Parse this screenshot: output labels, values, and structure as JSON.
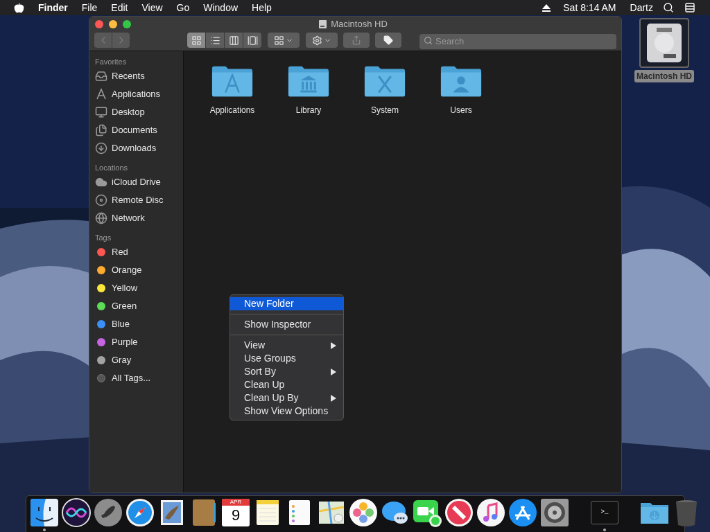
{
  "menu_bar": {
    "items": [
      {
        "label": "Finder",
        "kind": "app"
      },
      {
        "label": "File",
        "kind": "menu"
      },
      {
        "label": "Edit",
        "kind": "menu"
      },
      {
        "label": "View",
        "kind": "menu"
      },
      {
        "label": "Go",
        "kind": "menu"
      },
      {
        "label": "Window",
        "kind": "menu"
      },
      {
        "label": "Help",
        "kind": "menu"
      }
    ],
    "clock": "Sat 8:14 AM",
    "user": "Dartz"
  },
  "window": {
    "title": "Macintosh HD",
    "toolbar": {
      "navigation": [
        {
          "disabled": true
        },
        {
          "disabled": true
        }
      ],
      "view_modes": [
        {
          "selected": true
        },
        {
          "selected": false
        },
        {
          "selected": false
        },
        {
          "selected": false
        }
      ],
      "share_disabled": true,
      "search": {
        "placeholder": "Search"
      }
    },
    "sidebar": [
      {
        "title": "Favorites",
        "items": [
          {
            "label": "Recents",
            "kind": "recents"
          },
          {
            "label": "Applications",
            "kind": "applications"
          },
          {
            "label": "Desktop",
            "kind": "desktop"
          },
          {
            "label": "Documents",
            "kind": "documents"
          },
          {
            "label": "Downloads",
            "kind": "downloads"
          }
        ]
      },
      {
        "title": "Locations",
        "items": [
          {
            "label": "iCloud Drive",
            "kind": "icloud"
          },
          {
            "label": "Remote Disc",
            "kind": "disc"
          },
          {
            "label": "Network",
            "kind": "network"
          }
        ]
      },
      {
        "title": "Tags",
        "items": [
          {
            "label": "Red",
            "kind": "tag",
            "color": "#fc5753"
          },
          {
            "label": "Orange",
            "kind": "tag",
            "color": "#fdab2f"
          },
          {
            "label": "Yellow",
            "kind": "tag",
            "color": "#fce83a"
          },
          {
            "label": "Green",
            "kind": "tag",
            "color": "#5ddc56"
          },
          {
            "label": "Blue",
            "kind": "tag",
            "color": "#3c8ff7"
          },
          {
            "label": "Purple",
            "kind": "tag",
            "color": "#c664e2"
          },
          {
            "label": "Gray",
            "kind": "tag",
            "color": "#a3a3a3"
          },
          {
            "label": "All Tags...",
            "kind": "all-tags"
          }
        ]
      }
    ],
    "files": [
      {
        "name": "Applications",
        "kind": "applications"
      },
      {
        "name": "Library",
        "kind": "library"
      },
      {
        "name": "System",
        "kind": "system"
      },
      {
        "name": "Users",
        "kind": "users"
      }
    ]
  },
  "desktop_icon": {
    "label": "Macintosh HD",
    "selected": true
  },
  "context_menu": [
    {
      "kind": "item",
      "label": "New Folder",
      "selected": true,
      "submenu": false
    },
    {
      "kind": "separator"
    },
    {
      "kind": "item",
      "label": "Show Inspector",
      "selected": false,
      "submenu": false
    },
    {
      "kind": "separator"
    },
    {
      "kind": "item",
      "label": "View",
      "selected": false,
      "submenu": true
    },
    {
      "kind": "item",
      "label": "Use Groups",
      "selected": false,
      "submenu": false
    },
    {
      "kind": "item",
      "label": "Sort By",
      "selected": false,
      "submenu": true
    },
    {
      "kind": "item",
      "label": "Clean Up",
      "selected": false,
      "submenu": false
    },
    {
      "kind": "item",
      "label": "Clean Up By",
      "selected": false,
      "submenu": true
    },
    {
      "kind": "item",
      "label": "Show View Options",
      "selected": false,
      "submenu": false
    }
  ],
  "dock": [
    {
      "kind": "finder",
      "running": true
    },
    {
      "kind": "siri",
      "running": false
    },
    {
      "kind": "launchpad",
      "running": false
    },
    {
      "kind": "safari",
      "running": false
    },
    {
      "kind": "mail",
      "running": false
    },
    {
      "kind": "contacts",
      "running": false
    },
    {
      "kind": "calendar",
      "running": false,
      "month": "APR",
      "day": "9"
    },
    {
      "kind": "notes",
      "running": false
    },
    {
      "kind": "reminders",
      "running": false
    },
    {
      "kind": "maps",
      "running": false
    },
    {
      "kind": "photos",
      "running": false
    },
    {
      "kind": "messages",
      "running": false
    },
    {
      "kind": "facetime",
      "running": false
    },
    {
      "kind": "news",
      "running": false
    },
    {
      "kind": "music",
      "running": false
    },
    {
      "kind": "appstore",
      "running": false
    },
    {
      "kind": "preferences",
      "running": false
    },
    {
      "kind": "separator"
    },
    {
      "kind": "terminal",
      "running": true,
      "prompt": ">_"
    },
    {
      "kind": "separator"
    },
    {
      "kind": "downloads",
      "running": false
    },
    {
      "kind": "trash",
      "running": false
    }
  ]
}
